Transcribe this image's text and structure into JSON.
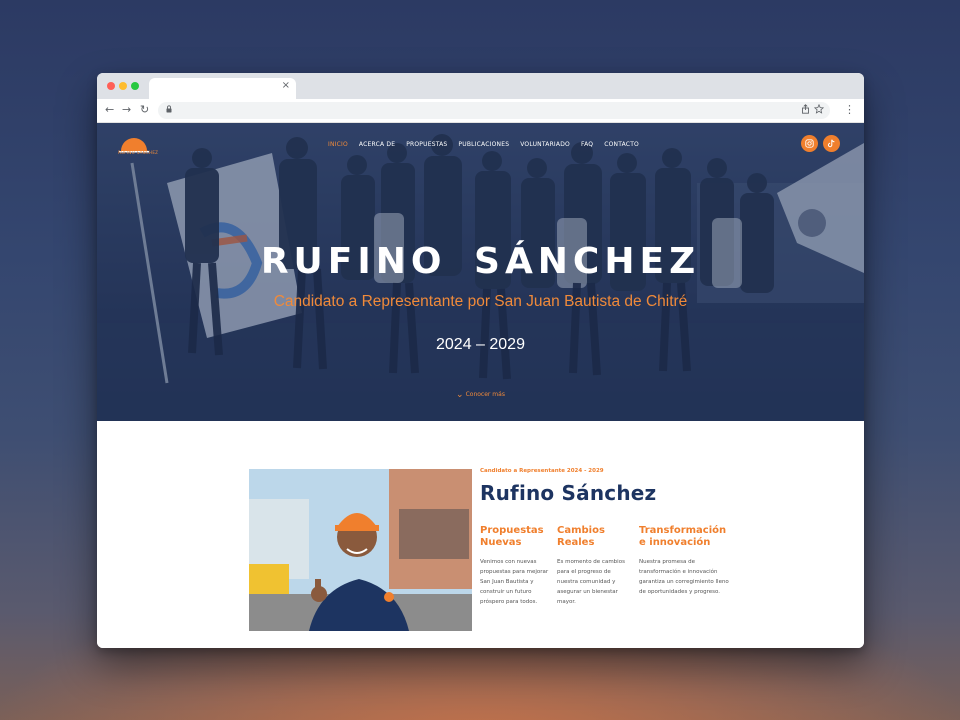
{
  "browser": {
    "tab_close": "×",
    "nav": {
      "back": "←",
      "forward": "→",
      "reload": "↻",
      "menu": "⋮"
    },
    "icons": [
      "lock-icon",
      "share-icon",
      "star-icon"
    ]
  },
  "site": {
    "logo_text": "RUFINO SÁNCHEZ",
    "nav": [
      "INICIO",
      "ACERCA DE",
      "PROPUESTAS",
      "PUBLICACIONES",
      "VOLUNTARIADO",
      "FAQ",
      "CONTACTO"
    ],
    "active_nav": "INICIO",
    "social": [
      "instagram-icon",
      "tiktok-icon"
    ],
    "hero": {
      "title": "RUFINO SÁNCHEZ",
      "subtitle": "Candidato a Representante por San Juan Bautista de Chitré",
      "years": "2024 – 2029",
      "more": "Conocer más"
    },
    "about": {
      "kicker": "Candidato a Representante 2024 - 2029",
      "name": "Rufino Sánchez",
      "columns": [
        {
          "title": "Propuestas Nuevas",
          "text": "Venimos con nuevas propuestas para mejorar San Juan Bautista y construir un futuro próspero para todos."
        },
        {
          "title": "Cambios Reales",
          "text": "Es momento de cambios para el progreso de nuestra comunidad y asegurar un bienestar mayor."
        },
        {
          "title": "Transformación e innovación",
          "text": "Nuestra promesa de transformación e innovación garantiza un corregimiento lleno de oportunidades y progreso."
        }
      ]
    }
  },
  "colors": {
    "accent": "#f07f2d",
    "navy": "#1d3461",
    "hero_bg": "#2c3d63"
  }
}
